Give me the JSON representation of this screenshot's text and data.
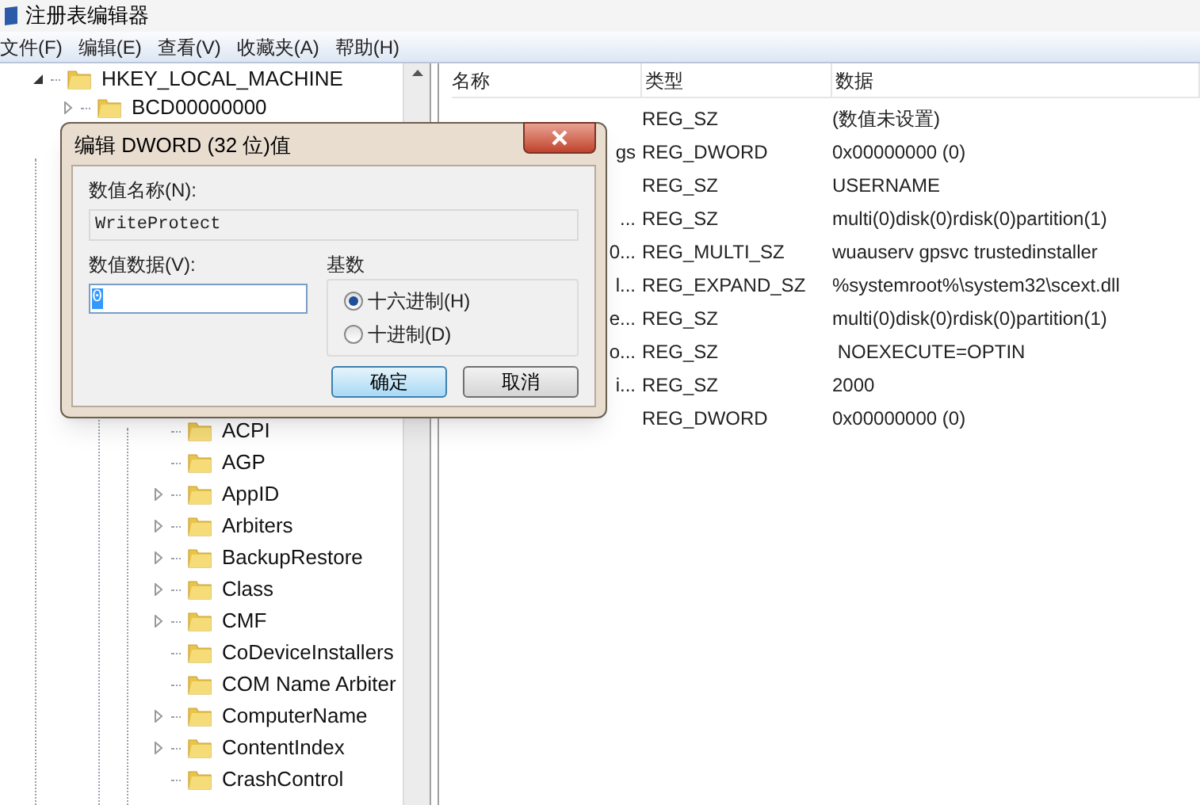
{
  "window": {
    "title": "注册表编辑器"
  },
  "menu": [
    "文件(F)",
    "编辑(E)",
    "查看(V)",
    "收藏夹(A)",
    "帮助(H)"
  ],
  "tree": [
    {
      "label": "HKEY_LOCAL_MACHINE",
      "expanded": true,
      "children": [
        {
          "label": "BCD00000000",
          "expanded": false
        }
      ]
    }
  ],
  "tree_lower": [
    {
      "label": "ACPI",
      "expandable": false
    },
    {
      "label": "AGP",
      "expandable": false
    },
    {
      "label": "AppID",
      "expandable": true
    },
    {
      "label": "Arbiters",
      "expandable": true
    },
    {
      "label": "BackupRestore",
      "expandable": true
    },
    {
      "label": "Class",
      "expandable": true
    },
    {
      "label": "CMF",
      "expandable": true
    },
    {
      "label": "CoDeviceInstallers",
      "expandable": false
    },
    {
      "label": "COM Name Arbiter",
      "expandable": false
    },
    {
      "label": "ComputerName",
      "expandable": true
    },
    {
      "label": "ContentIndex",
      "expandable": true
    },
    {
      "label": "CrashControl",
      "expandable": false
    }
  ],
  "list": {
    "columns": [
      "名称",
      "类型",
      "数据"
    ],
    "rows": [
      {
        "type": "REG_SZ",
        "data": "(数值未设置)"
      },
      {
        "name": "gs",
        "type": "REG_DWORD",
        "data": "0x00000000 (0)"
      },
      {
        "type": "REG_SZ",
        "data": "USERNAME"
      },
      {
        "name": "...",
        "type": "REG_SZ",
        "data": "multi(0)disk(0)rdisk(0)partition(1)"
      },
      {
        "name": "0...",
        "type": "REG_MULTI_SZ",
        "data": "wuauserv gpsvc trustedinstaller"
      },
      {
        "name": "l...",
        "type": "REG_EXPAND_SZ",
        "data": "%systemroot%\\system32\\scext.dll"
      },
      {
        "name": "e...",
        "type": "REG_SZ",
        "data": "multi(0)disk(0)rdisk(0)partition(1)"
      },
      {
        "name": "o...",
        "type": "REG_SZ",
        "data": " NOEXECUTE=OPTIN"
      },
      {
        "name": "i...",
        "type": "REG_SZ",
        "data": "2000"
      },
      {
        "type": "REG_DWORD",
        "data": "0x00000000 (0)"
      }
    ]
  },
  "dialog": {
    "title": "编辑 DWORD (32 位)值",
    "name_label": "数值名称(N):",
    "name_value": "WriteProtect",
    "data_label": "数值数据(V):",
    "data_value": "0",
    "base_label": "基数",
    "radios": [
      {
        "label": "十六进制(H)",
        "selected": true
      },
      {
        "label": "十进制(D)",
        "selected": false
      }
    ],
    "buttons": [
      {
        "label": "确定",
        "kind": "default"
      },
      {
        "label": "取消",
        "kind": "normal"
      }
    ]
  }
}
